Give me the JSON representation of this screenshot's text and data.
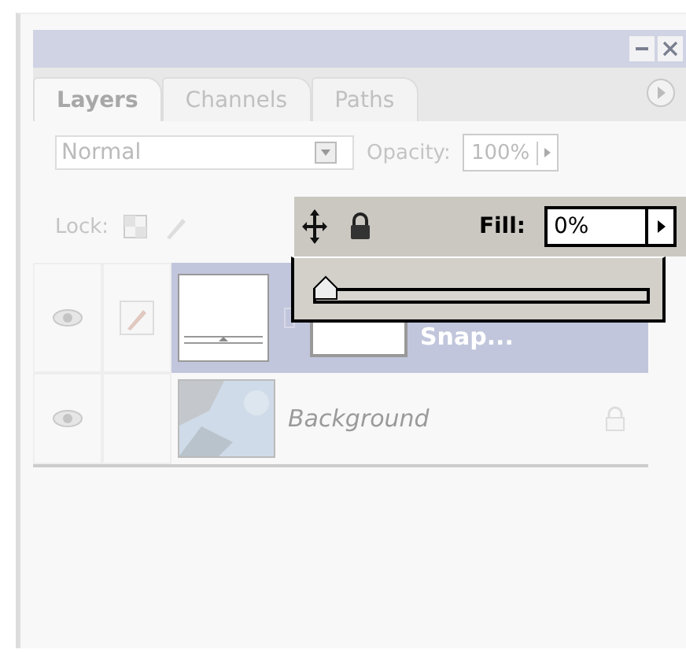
{
  "tabs": [
    {
      "label": "Layers",
      "selected": true
    },
    {
      "label": "Channels",
      "selected": false
    },
    {
      "label": "Paths",
      "selected": false
    }
  ],
  "blend_mode": "Normal",
  "opacity": {
    "label": "Opacity:",
    "value": "100%"
  },
  "lock": {
    "label": "Lock:"
  },
  "fill": {
    "label": "Fill:",
    "value": "0%",
    "level": 0
  },
  "layers": [
    {
      "name": "Snap...",
      "kind": "layer",
      "selected": true
    },
    {
      "name": "Background",
      "kind": "background",
      "selected": false
    }
  ]
}
